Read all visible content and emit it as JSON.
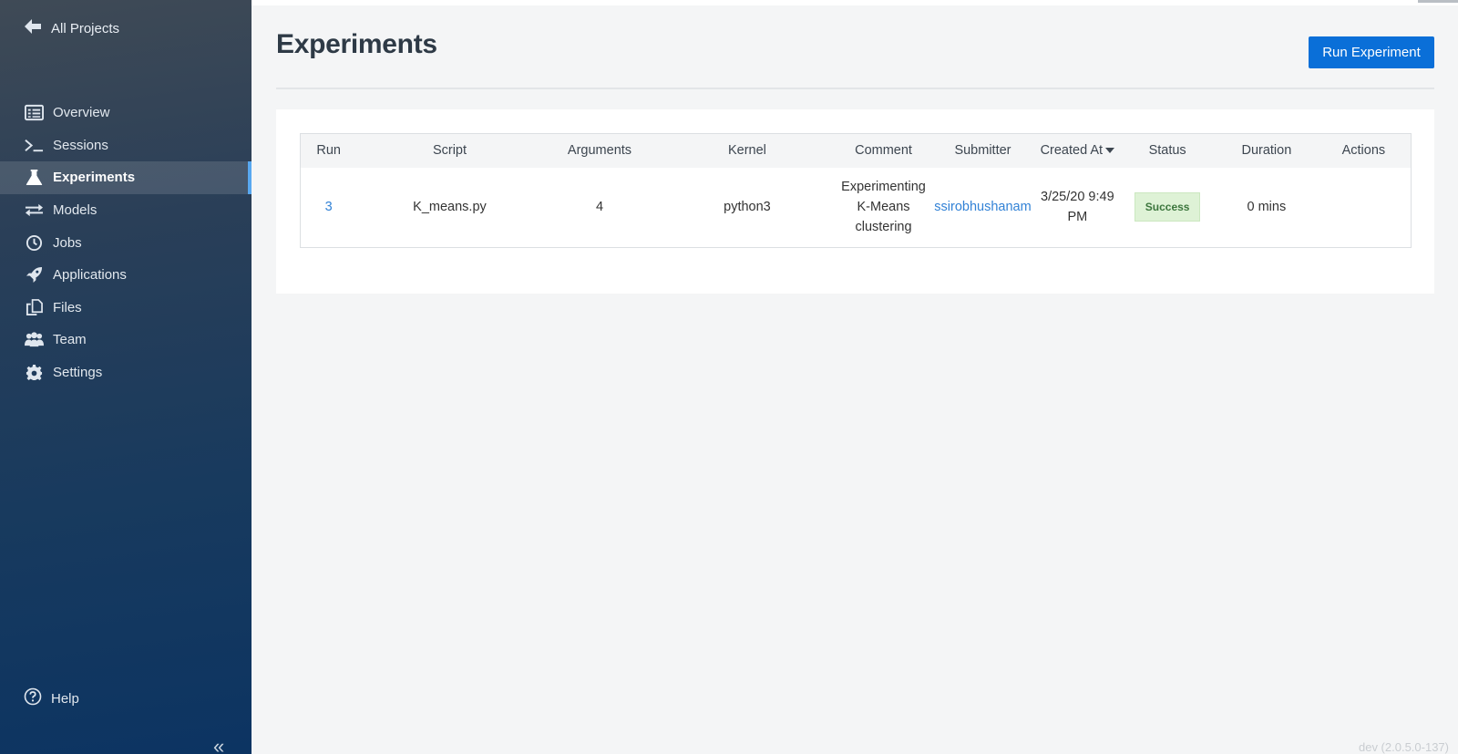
{
  "sidebar": {
    "back_label": "All Projects",
    "items": [
      {
        "label": "Overview",
        "icon": "overview-icon"
      },
      {
        "label": "Sessions",
        "icon": "terminal-icon"
      },
      {
        "label": "Experiments",
        "icon": "flask-icon",
        "active": true
      },
      {
        "label": "Models",
        "icon": "arrows-icon"
      },
      {
        "label": "Jobs",
        "icon": "clock-icon"
      },
      {
        "label": "Applications",
        "icon": "rocket-icon"
      },
      {
        "label": "Files",
        "icon": "files-icon"
      },
      {
        "label": "Team",
        "icon": "team-icon"
      },
      {
        "label": "Settings",
        "icon": "gear-icon"
      }
    ],
    "help_label": "Help",
    "collapse_glyph": "«"
  },
  "main": {
    "title": "Experiments",
    "run_button_label": "Run Experiment",
    "table": {
      "headers": [
        "Run",
        "Script",
        "Arguments",
        "Kernel",
        "Comment",
        "Submitter",
        "Created At",
        "Status",
        "Duration",
        "Actions"
      ],
      "rows": [
        {
          "run": "3",
          "script": "K_means.py",
          "arguments": "4",
          "kernel": "python3",
          "comment": "Experimenting K-Means clustering",
          "submitter": "ssirobhushanam",
          "created_at": "3/25/20 9:49 PM",
          "status": "Success",
          "duration": "0 mins",
          "actions": ""
        }
      ]
    }
  },
  "footer": {
    "version": "dev (2.0.5.0-137)"
  },
  "colors": {
    "accent": "#0a6fd8",
    "link": "#3282d6",
    "success_bg": "#def2d6",
    "success_text": "#3c763d"
  }
}
